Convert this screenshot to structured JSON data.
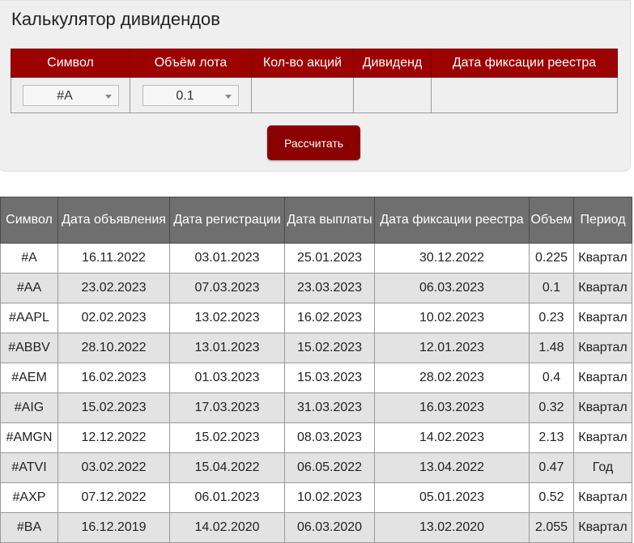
{
  "calculator": {
    "title": "Калькулятор дивидендов",
    "headers": [
      "Символ",
      "Объём лота",
      "Кол-во акций",
      "Дивиденд",
      "Дата фиксации реестра"
    ],
    "symbol_value": "#A",
    "lot_value": "0.1",
    "calculate_label": "Рассчитать"
  },
  "dividends": {
    "headers": [
      "Символ",
      "Дата объявления",
      "Дата регистрации",
      "Дата выплаты",
      "Дата фиксации реестра",
      "Объем",
      "Период"
    ],
    "rows": [
      [
        "#A",
        "16.11.2022",
        "03.01.2023",
        "25.01.2023",
        "30.12.2022",
        "0.225",
        "Квартал"
      ],
      [
        "#AA",
        "23.02.2023",
        "07.03.2023",
        "23.03.2023",
        "06.03.2023",
        "0.1",
        "Квартал"
      ],
      [
        "#AAPL",
        "02.02.2023",
        "13.02.2023",
        "16.02.2023",
        "10.02.2023",
        "0.23",
        "Квартал"
      ],
      [
        "#ABBV",
        "28.10.2022",
        "13.01.2023",
        "15.02.2023",
        "12.01.2023",
        "1.48",
        "Квартал"
      ],
      [
        "#AEM",
        "16.02.2023",
        "01.03.2023",
        "15.03.2023",
        "28.02.2023",
        "0.4",
        "Квартал"
      ],
      [
        "#AIG",
        "15.02.2023",
        "17.03.2023",
        "31.03.2023",
        "16.03.2023",
        "0.32",
        "Квартал"
      ],
      [
        "#AMGN",
        "12.12.2022",
        "15.02.2023",
        "08.03.2023",
        "14.02.2023",
        "2.13",
        "Квартал"
      ],
      [
        "#ATVI",
        "03.02.2022",
        "15.04.2022",
        "06.05.2022",
        "13.04.2022",
        "0.47",
        "Год"
      ],
      [
        "#AXP",
        "07.12.2022",
        "06.01.2023",
        "10.02.2023",
        "05.01.2023",
        "0.52",
        "Квартал"
      ],
      [
        "#BA",
        "16.12.2019",
        "14.02.2020",
        "06.03.2020",
        "13.02.2020",
        "2.055",
        "Квартал"
      ]
    ]
  },
  "colors": {
    "accent_header": "#9d0000",
    "button": "#8b0000",
    "table_header": "#6f6f6f"
  }
}
